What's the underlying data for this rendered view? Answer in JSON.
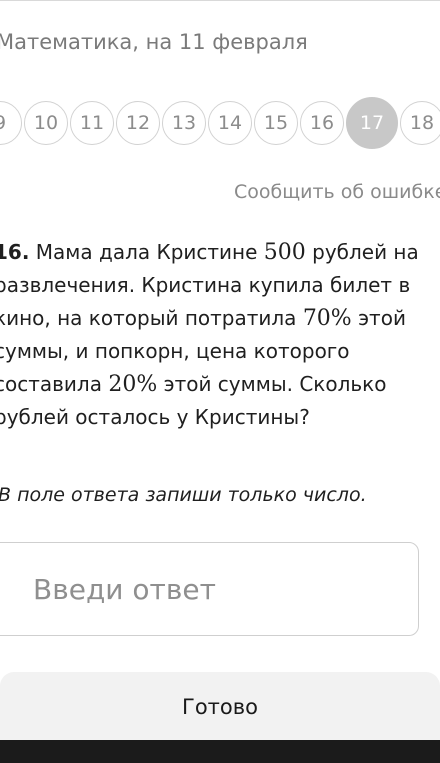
{
  "header": {
    "title": "Математика, на 11 февраля"
  },
  "pager": {
    "pages": [
      "9",
      "10",
      "11",
      "12",
      "13",
      "14",
      "15",
      "16",
      "17",
      "18"
    ],
    "active": "17"
  },
  "report_link": "Сообщить об ошибке",
  "task": {
    "number": "16.",
    "part1": " Мама дала Кристине ",
    "amount": "500",
    "part2": " рублей на развлечения. Кристина купила билет в кино, на который потратила ",
    "percent1": "70%",
    "part3": " этой суммы, и попкорн, цена которого составила ",
    "percent2": "20%",
    "part4": " этой суммы. Сколько рублей осталось у Кристины?"
  },
  "hint": "В поле ответа запиши только число.",
  "answer": {
    "placeholder": "Введи ответ",
    "value": ""
  },
  "done_label": "Готово"
}
